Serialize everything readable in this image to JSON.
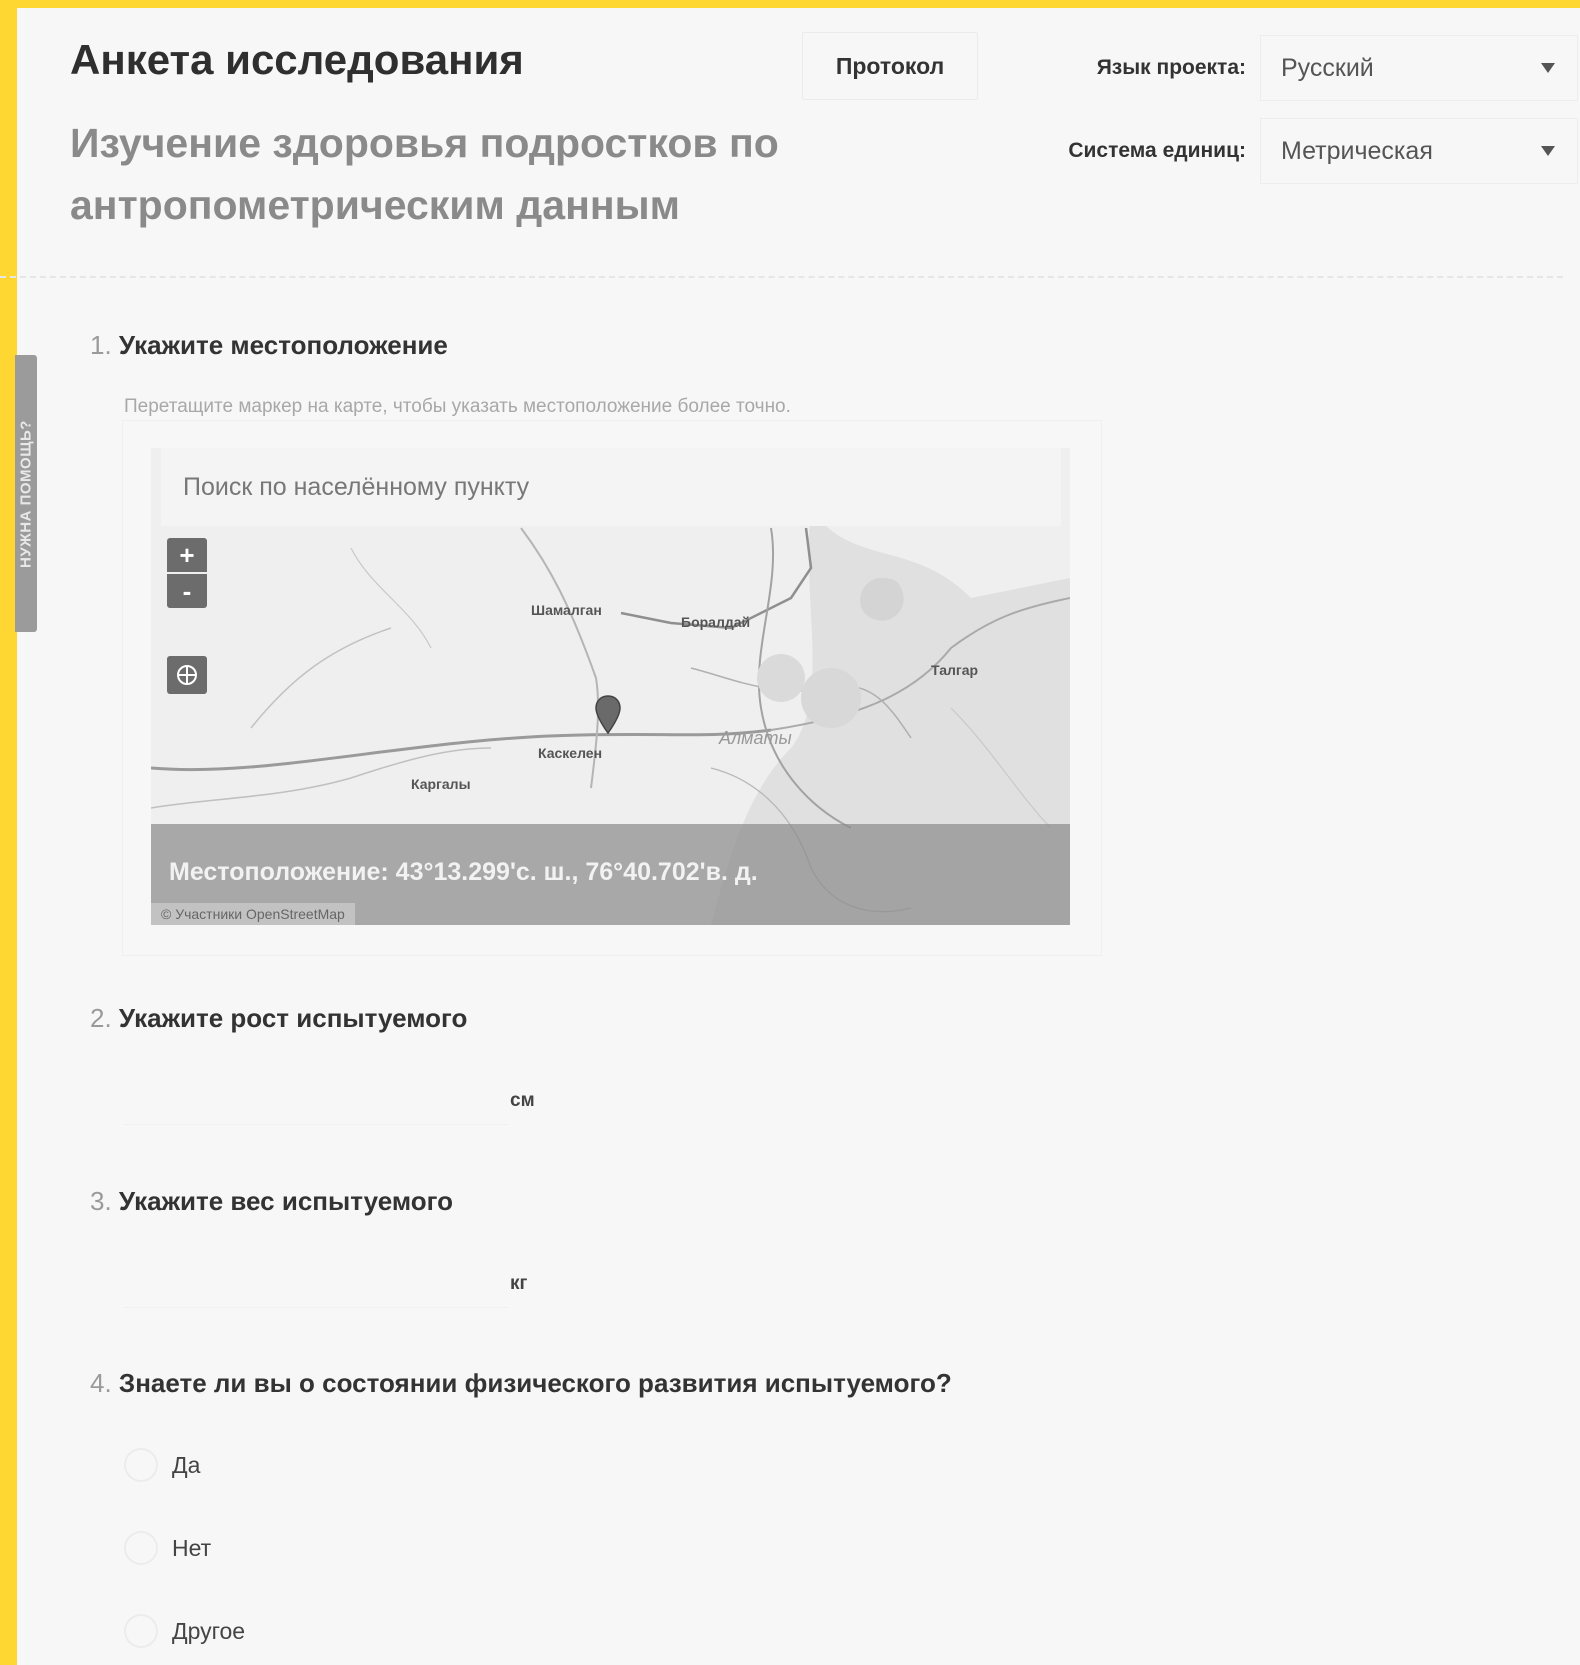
{
  "help_tab": {
    "label": "НУЖНА ПОМОЩЬ?"
  },
  "header": {
    "title": "Анкета исследования",
    "subtitle": "Изучение здоровья подростков по антропометрическим данным",
    "protocol_button": "Протокол",
    "language_label": "Язык проекта:",
    "language_value": "Русский",
    "units_label": "Система единиц:",
    "units_value": "Метрическая"
  },
  "questions": {
    "q1": {
      "num": "1.",
      "title": "Укажите местоположение",
      "hint": "Перетащите маркер на карте, чтобы указать местоположение более точно.",
      "map": {
        "search_placeholder": "Поиск по населённому пункту",
        "zoom_in": "+",
        "zoom_out": "-",
        "places": {
          "shamalgan": "Шамалган",
          "boraldai": "Боралдай",
          "talgar": "Талгар",
          "almaty": "Алматы",
          "kaskelen": "Каскелен",
          "kargaly": "Каргалы"
        },
        "location": "Местоположение: 43°13.299'с. ш., 76°40.702'в. д.",
        "attribution": "© Участники OpenStreetMap"
      }
    },
    "q2": {
      "num": "2.",
      "title": "Укажите рост испытуемого",
      "unit": "см"
    },
    "q3": {
      "num": "3.",
      "title": "Укажите вес испытуемого",
      "unit": "кг"
    },
    "q4": {
      "num": "4.",
      "title": "Знаете ли вы о состоянии физического развития испытуемого?",
      "options": [
        "Да",
        "Нет",
        "Другое"
      ]
    }
  }
}
